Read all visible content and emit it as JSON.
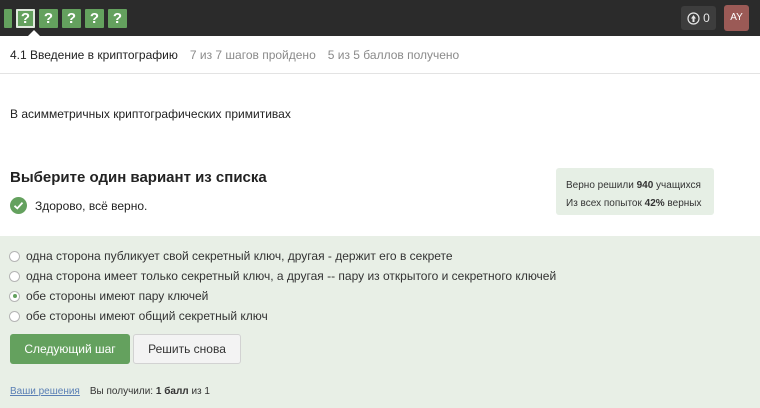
{
  "colors": {
    "accent": "#64a15e",
    "topbar_bg": "#2b2b2b",
    "answers_bg": "#e8efe6",
    "stats_bg": "#e6efe5",
    "avatar_bg": "#9b5a56",
    "link": "#5a7fb5"
  },
  "topbar": {
    "steps": [
      {
        "label": "",
        "icon": "step-marker"
      },
      {
        "label": "?",
        "current": true
      },
      {
        "label": "?"
      },
      {
        "label": "?"
      },
      {
        "label": "?"
      },
      {
        "label": "?"
      }
    ],
    "reputation_icon": "rating-icon",
    "reputation": "0",
    "avatar_initials": "AY"
  },
  "header": {
    "lesson_title": "4.1 Введение в криптографию",
    "steps_progress": "7 из 7 шагов пройдено",
    "points": "5 из 5 баллов  получено"
  },
  "question": {
    "text": "В асимметричных криптографических примитивах"
  },
  "quiz": {
    "prompt": "Выберите один вариант из списка",
    "feedback": "Здорово, всё верно.",
    "options": [
      {
        "text": "одна сторона публикует свой секретный ключ, другая - держит его в секрете",
        "selected": false
      },
      {
        "text": "одна сторона имеет только секретный ключ, а другая -- пару из открытого и секретного ключей",
        "selected": false
      },
      {
        "text": "обе стороны имеют пару ключей",
        "selected": true
      },
      {
        "text": "обе стороны имеют общий секретный ключ",
        "selected": false
      }
    ],
    "next_button": "Следующий шаг",
    "retry_button": "Решить снова"
  },
  "stats": {
    "solved_prefix": "Верно решили ",
    "solved_count": "940",
    "solved_suffix": " учащихся",
    "attempts_prefix": "Из всех попыток ",
    "attempts_percent": "42%",
    "attempts_suffix": " верных"
  },
  "footer": {
    "solutions_link": "Ваши решения",
    "received_prefix": "Вы получили: ",
    "received_score": "1 балл",
    "received_suffix": " из 1"
  }
}
